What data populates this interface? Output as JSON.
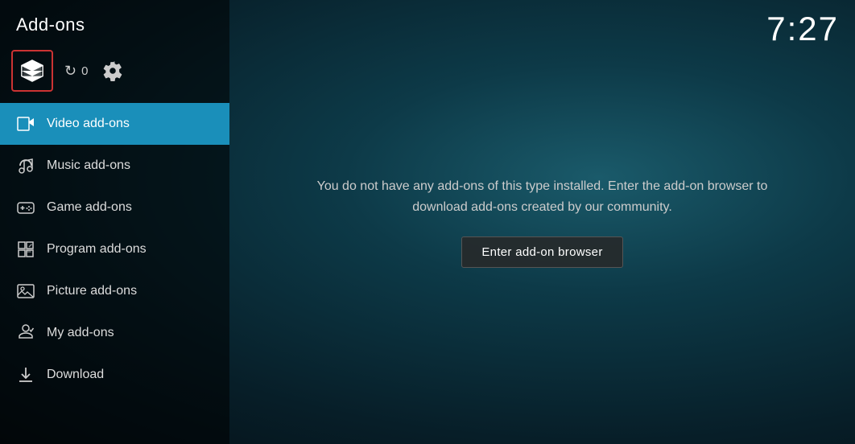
{
  "header": {
    "title": "Add-ons",
    "clock": "7:27"
  },
  "sidebar": {
    "icons": {
      "refresh_count": "0"
    },
    "nav_items": [
      {
        "id": "video",
        "label": "Video add-ons",
        "icon": "video-icon",
        "active": true
      },
      {
        "id": "music",
        "label": "Music add-ons",
        "icon": "music-icon",
        "active": false
      },
      {
        "id": "game",
        "label": "Game add-ons",
        "icon": "game-icon",
        "active": false
      },
      {
        "id": "program",
        "label": "Program add-ons",
        "icon": "program-icon",
        "active": false
      },
      {
        "id": "picture",
        "label": "Picture add-ons",
        "icon": "picture-icon",
        "active": false
      },
      {
        "id": "myaddon",
        "label": "My add-ons",
        "icon": "myaddon-icon",
        "active": false
      },
      {
        "id": "download",
        "label": "Download",
        "icon": "download-icon",
        "active": false
      }
    ]
  },
  "main": {
    "empty_message_line1": "You do not have any add-ons of this type installed. Enter the add-on browser to",
    "empty_message_line2": "download add-ons created by our community.",
    "browser_button_label": "Enter add-on browser"
  }
}
